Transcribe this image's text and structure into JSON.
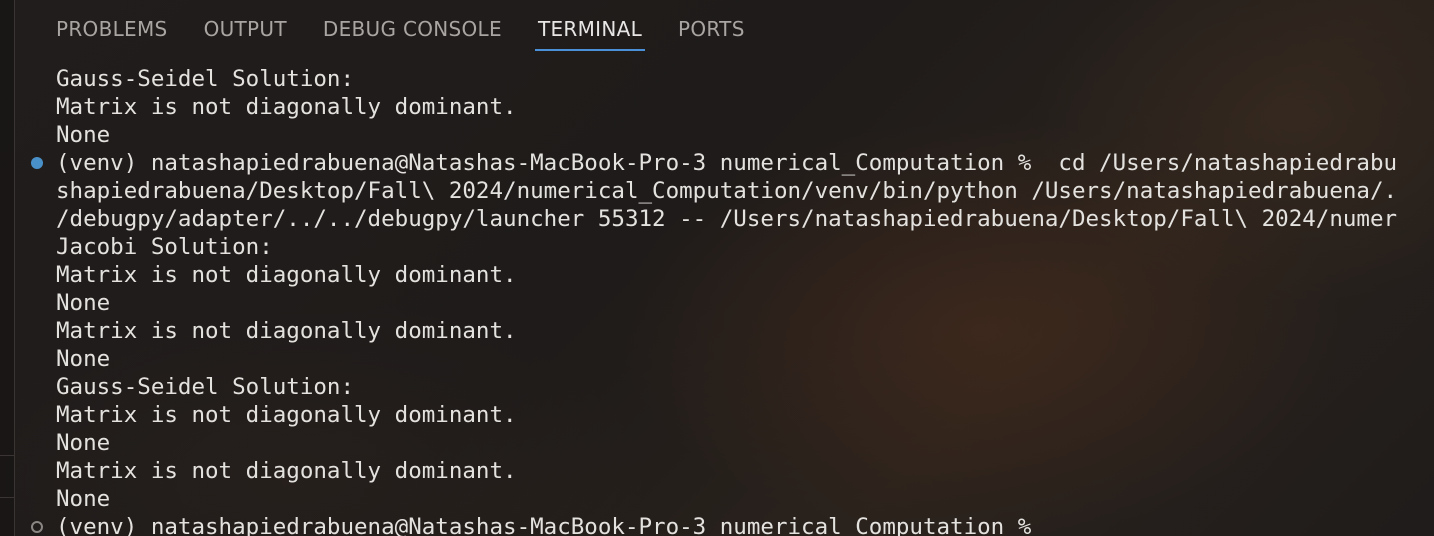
{
  "panel": {
    "tabs": [
      {
        "label": "PROBLEMS",
        "active": false
      },
      {
        "label": "OUTPUT",
        "active": false
      },
      {
        "label": "DEBUG CONSOLE",
        "active": false
      },
      {
        "label": "TERMINAL",
        "active": true
      },
      {
        "label": "PORTS",
        "active": false
      }
    ],
    "accent_color": "#4a90d9"
  },
  "terminal": {
    "lines": [
      "Gauss-Seidel Solution:",
      "Matrix is not diagonally dominant.",
      "None",
      "(venv) natashapiedrabuena@Natashas-MacBook-Pro-3 numerical_Computation %  cd /Users/natashapiedrabu",
      "shapiedrabuena/Desktop/Fall\\ 2024/numerical_Computation/venv/bin/python /Users/natashapiedrabuena/.",
      "/debugpy/adapter/../../debugpy/launcher 55312 -- /Users/natashapiedrabuena/Desktop/Fall\\ 2024/numer",
      "Jacobi Solution:",
      "Matrix is not diagonally dominant.",
      "None",
      "Matrix is not diagonally dominant.",
      "None",
      "Gauss-Seidel Solution:",
      "Matrix is not diagonally dominant.",
      "None",
      "Matrix is not diagonally dominant.",
      "None",
      "(venv) natashapiedrabuena@Natashas-MacBook-Pro-3 numerical_Computation %"
    ],
    "markers": [
      {
        "line_index": 3,
        "type": "filled",
        "icon": "command-success-dot-icon",
        "color": "#4a90c8"
      },
      {
        "line_index": 16,
        "type": "hollow",
        "icon": "command-pending-circle-icon",
        "color": "#8a8683"
      }
    ]
  }
}
